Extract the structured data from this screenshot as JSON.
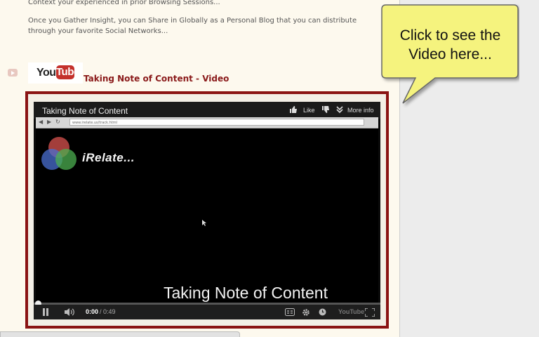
{
  "page": {
    "paragraph_top": "Context your experienced in prior Browsing Sessions...",
    "paragraph_main_line1": "Once you Gather Insight, you can Share in Globally as a Personal Blog that you can distribute",
    "paragraph_main_line2": "through your favorite Social Networks..."
  },
  "youtube": {
    "logo_you": "You",
    "logo_tube": "Tube",
    "video_link_title": "Taking Note of Content - Video"
  },
  "player": {
    "title": "Taking Note of Content",
    "like_label": "Like",
    "more_info_label": "More info",
    "browser_address": "www.irelate.us/track.html",
    "overlay_brand": "iRelate...",
    "caption": "Taking Note of Content",
    "time_current": "0:00",
    "time_total": "/ 0:49",
    "control_logo": "YouTube",
    "progress_fraction": 0.0
  },
  "callout": {
    "line1": "Click to see the",
    "line2": "Video here...",
    "fill_color": "#f5f37e"
  },
  "colors": {
    "frame": "#8a1313",
    "link_title": "#8a1a1a",
    "youtube_red": "#c4302b"
  }
}
